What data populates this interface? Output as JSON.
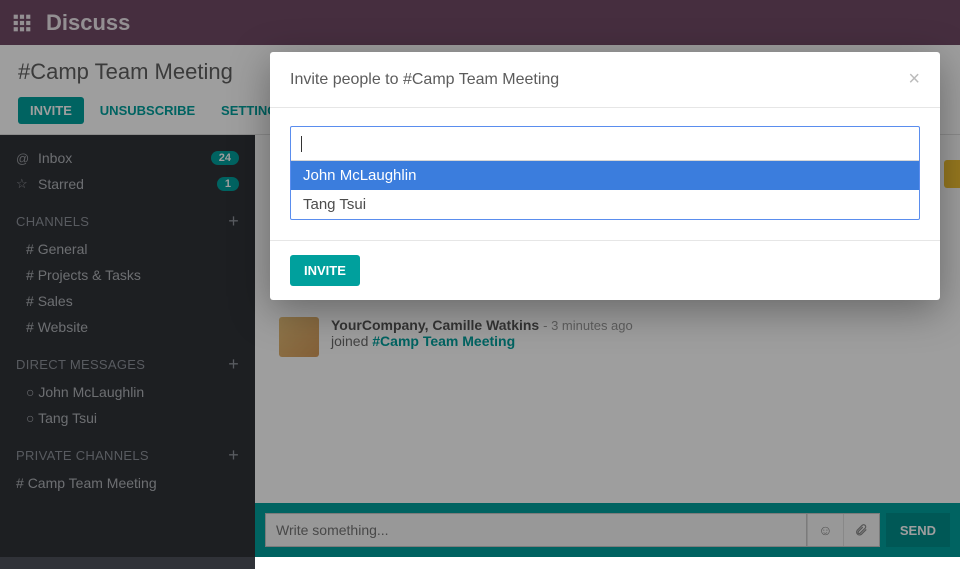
{
  "topbar": {
    "title": "Discuss"
  },
  "channel_header": {
    "title": "#Camp Team Meeting",
    "invite_label": "INVITE",
    "unsubscribe_label": "UNSUBSCRIBE",
    "settings_label": "SETTINGS"
  },
  "sidebar": {
    "inbox": {
      "label": "Inbox",
      "badge": "24"
    },
    "starred": {
      "label": "Starred",
      "badge": "1"
    },
    "sections": {
      "channels": "CHANNELS",
      "direct": "DIRECT MESSAGES",
      "private": "PRIVATE CHANNELS"
    },
    "channels": [
      {
        "label": "General"
      },
      {
        "label": "Projects & Tasks"
      },
      {
        "label": "Sales"
      },
      {
        "label": "Website"
      }
    ],
    "direct": [
      {
        "label": "John McLaughlin"
      },
      {
        "label": "Tang Tsui"
      }
    ],
    "private": [
      {
        "label": "Camp Team Meeting"
      }
    ]
  },
  "thread": {
    "msg": {
      "author": "YourCompany, Camille Watkins",
      "time": "3 minutes ago",
      "verb": "joined",
      "target": "#Camp Team Meeting"
    }
  },
  "composer": {
    "placeholder": "Write something...",
    "send_label": "SEND"
  },
  "modal": {
    "title": "Invite people to #Camp Team Meeting",
    "options": [
      {
        "label": "John McLaughlin"
      },
      {
        "label": "Tang Tsui"
      }
    ],
    "invite_label": "INVITE"
  }
}
